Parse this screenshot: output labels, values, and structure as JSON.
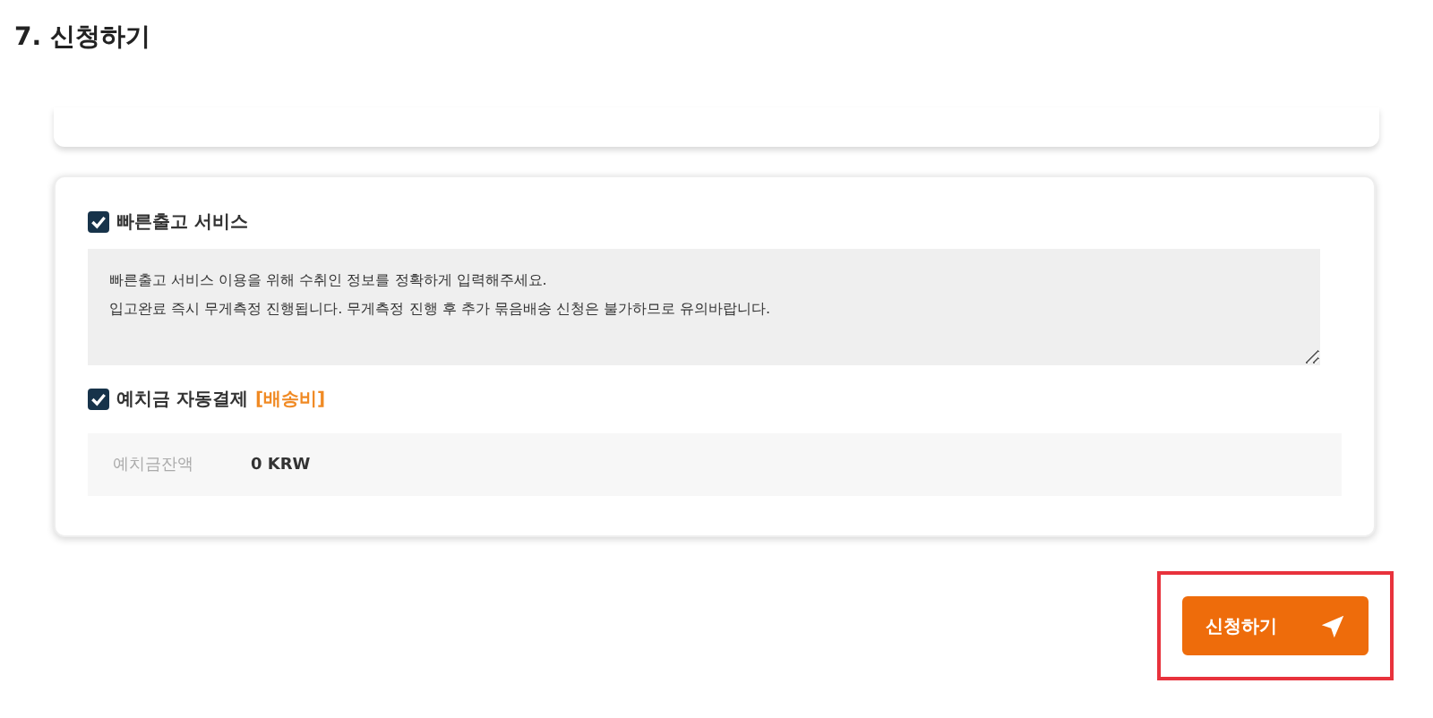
{
  "section_title": "7. 신청하기",
  "express_service": {
    "label": "빠른출고 서비스",
    "checked": true,
    "notice": "빠른출고 서비스 이용을 위해 수취인 정보를 정확하게 입력해주세요.\n입고완료 즉시 무게측정 진행됩니다. 무게측정 진행 후 추가 묶음배송 신청은 불가하므로 유의바랍니다."
  },
  "auto_payment": {
    "label": "예치금 자동결제",
    "tag": "[배송비]",
    "checked": true
  },
  "balance": {
    "label": "예치금잔액",
    "value": "0 KRW"
  },
  "submit_button": {
    "label": "신청하기",
    "highlighted": true
  }
}
